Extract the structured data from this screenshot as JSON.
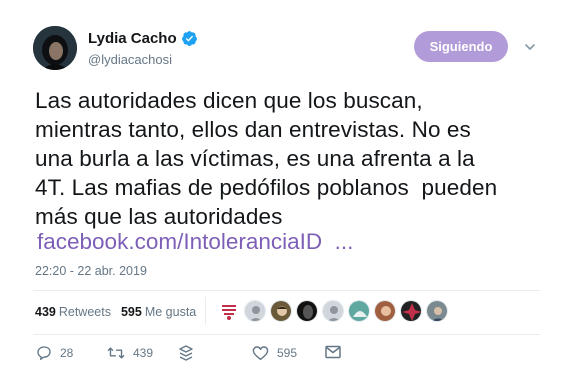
{
  "author": {
    "name": "Lydia Cacho",
    "handle": "@lydiacachosi",
    "verified": true
  },
  "follow_button": {
    "label": "Siguiendo"
  },
  "tweet": {
    "lines": [
      "Las autoridades dicen que los buscan,",
      "mientras tanto, ellos dan entrevistas. No es",
      "una burla a las víctimas, es una afrenta a la",
      "4T. Las mafias de pedófilos poblanos  pueden",
      "más que las autoridades"
    ],
    "link": "facebook.com/IntoleranciaID  ...",
    "timestamp": "22:20 - 22 abr. 2019"
  },
  "stats": {
    "retweets": {
      "count": "439",
      "label": "Retweets"
    },
    "likes": {
      "count": "595",
      "label": "Me gusta"
    }
  },
  "actions": {
    "reply": {
      "icon": "reply-icon",
      "count": "28"
    },
    "retweet": {
      "icon": "retweet-icon",
      "count": "439"
    },
    "stack": {
      "icon": "layers-icon"
    },
    "like": {
      "icon": "heart-icon",
      "count": "595"
    },
    "message": {
      "icon": "envelope-icon"
    }
  },
  "colors": {
    "follow_button": "#b19bd8",
    "link": "#7e5fb8",
    "verified": "#1da1f2",
    "muted": "#657786"
  }
}
